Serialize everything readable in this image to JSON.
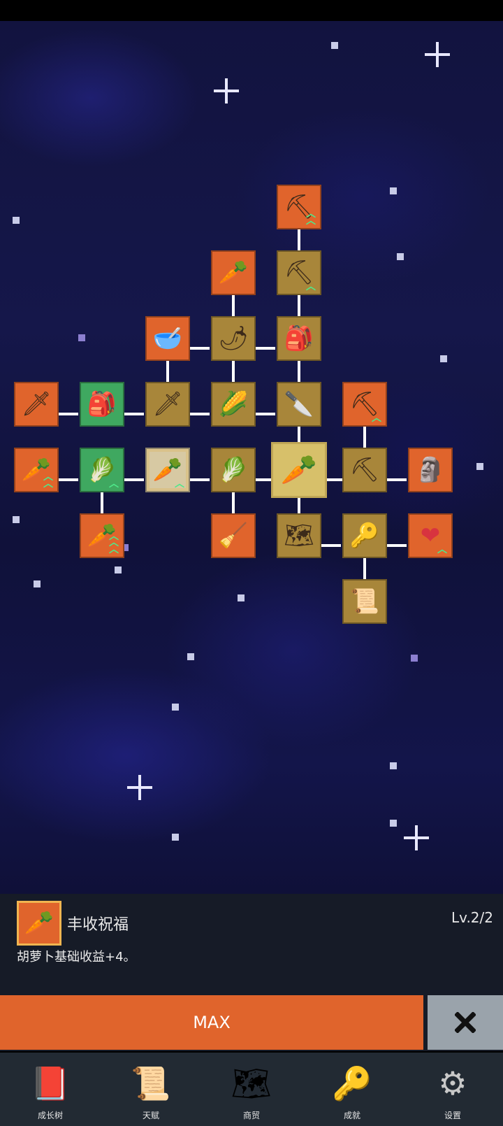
{
  "skill_tree": {
    "nodes": [
      {
        "id": "shovel-top",
        "icon": "shovel-icon",
        "glyph": "⛏",
        "color": "orange",
        "upgrade": "double-chevron"
      },
      {
        "id": "shovel",
        "icon": "shovel-icon",
        "glyph": "⛏",
        "color": "olive",
        "upgrade": "chevron"
      },
      {
        "id": "radish",
        "icon": "radish-icon",
        "glyph": "🥕",
        "color": "orange",
        "upgrade": "none"
      },
      {
        "id": "bowl",
        "icon": "bowl-icon",
        "glyph": "🥣",
        "color": "orange",
        "upgrade": "none"
      },
      {
        "id": "chili",
        "icon": "chili-icon",
        "glyph": "🌶",
        "color": "olive",
        "upgrade": "none"
      },
      {
        "id": "backpack-top",
        "icon": "backpack-icon",
        "glyph": "🎒",
        "color": "olive",
        "upgrade": "none"
      },
      {
        "id": "sword-left",
        "icon": "sword-icon",
        "glyph": "🗡",
        "color": "orange",
        "upgrade": "none"
      },
      {
        "id": "backpack-left",
        "icon": "backpack-icon",
        "glyph": "🎒",
        "color": "green",
        "upgrade": "none"
      },
      {
        "id": "sword",
        "icon": "sword-icon",
        "glyph": "🗡",
        "color": "olive",
        "upgrade": "none"
      },
      {
        "id": "corn",
        "icon": "corn-icon",
        "glyph": "🌽",
        "color": "olive",
        "upgrade": "none"
      },
      {
        "id": "knife",
        "icon": "knife-icon",
        "glyph": "🔪",
        "color": "olive",
        "upgrade": "none"
      },
      {
        "id": "pickaxe-top",
        "icon": "pickaxe-icon",
        "glyph": "⛏",
        "color": "orange",
        "upgrade": "chevron"
      },
      {
        "id": "carrot-left",
        "icon": "carrot-icon",
        "glyph": "🥕",
        "color": "orange",
        "upgrade": "double-chevron"
      },
      {
        "id": "cabbage-left",
        "icon": "cabbage-icon",
        "glyph": "🥬",
        "color": "green",
        "upgrade": "chevron"
      },
      {
        "id": "carrot-maxed",
        "icon": "carrot-icon",
        "glyph": "🥕",
        "color": "beige",
        "upgrade": "chevron"
      },
      {
        "id": "cabbage",
        "icon": "cabbage-icon",
        "glyph": "🥬",
        "color": "olive",
        "upgrade": "none"
      },
      {
        "id": "carrot-center",
        "icon": "carrot-icon",
        "glyph": "🥕",
        "color": "selected",
        "upgrade": "none"
      },
      {
        "id": "pickaxe",
        "icon": "pickaxe-icon",
        "glyph": "⛏",
        "color": "olive",
        "upgrade": "none"
      },
      {
        "id": "statue",
        "icon": "statue-icon",
        "glyph": "🗿",
        "color": "orange",
        "upgrade": "none"
      },
      {
        "id": "carrot-bottom",
        "icon": "carrot-icon",
        "glyph": "🥕",
        "color": "orange",
        "upgrade": "triple-chevron"
      },
      {
        "id": "broom",
        "icon": "broom-icon",
        "glyph": "🧹",
        "color": "orange",
        "upgrade": "none"
      },
      {
        "id": "map",
        "icon": "map-icon",
        "glyph": "🗺",
        "color": "olive",
        "upgrade": "none"
      },
      {
        "id": "key",
        "icon": "key-icon",
        "glyph": "🔑",
        "color": "olive",
        "upgrade": "none"
      },
      {
        "id": "heart",
        "icon": "heart-icon",
        "glyph": "❤",
        "color": "orange",
        "upgrade": "chevron"
      },
      {
        "id": "scroll",
        "icon": "scroll-icon",
        "glyph": "📜",
        "color": "olive",
        "upgrade": "none"
      }
    ]
  },
  "selected_skill": {
    "icon": "carrot-icon",
    "name": "丰收祝福",
    "level": "Lv.2/2",
    "description": "胡萝卜基础收益+4。"
  },
  "actions": {
    "max_label": "MAX",
    "close_icon": "close-icon"
  },
  "nav": [
    {
      "icon": "book-icon",
      "glyph": "📕",
      "label": "成长树"
    },
    {
      "icon": "scroll-icon",
      "glyph": "📜",
      "label": "天赋"
    },
    {
      "icon": "map-icon",
      "glyph": "🗺",
      "label": "商贸"
    },
    {
      "icon": "key-icon",
      "glyph": "🔑",
      "label": "成就"
    },
    {
      "icon": "gear-icon",
      "glyph": "⚙",
      "label": "设置"
    }
  ],
  "colors": {
    "orange": "#e0642c",
    "olive": "#a8863a",
    "green": "#3fa860",
    "panel": "#161b27",
    "navbar": "#222a33",
    "close_button": "#9aa3ab"
  }
}
